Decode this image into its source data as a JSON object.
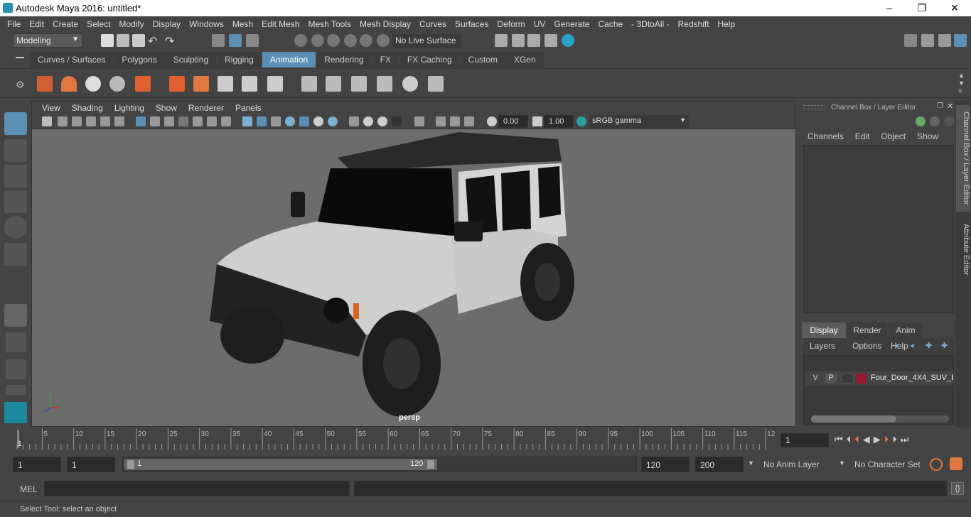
{
  "window": {
    "title": "Autodesk Maya 2016: untitled*",
    "minimize": "–",
    "restore": "❐",
    "close": "✕"
  },
  "menu": [
    "File",
    "Edit",
    "Create",
    "Select",
    "Modify",
    "Display",
    "Windows",
    "Mesh",
    "Edit Mesh",
    "Mesh Tools",
    "Mesh Display",
    "Curves",
    "Surfaces",
    "Deform",
    "UV",
    "Generate",
    "Cache",
    "- 3DtoAll -",
    "Redshift",
    "Help"
  ],
  "status": {
    "mode": "Modeling",
    "live_surface": "No Live Surface"
  },
  "shelf_tabs": [
    "Curves / Surfaces",
    "Polygons",
    "Sculpting",
    "Rigging",
    "Animation",
    "Rendering",
    "FX",
    "FX Caching",
    "Custom",
    "XGen"
  ],
  "shelf_active": "Animation",
  "viewport": {
    "menu": [
      "View",
      "Shading",
      "Lighting",
      "Show",
      "Renderer",
      "Panels"
    ],
    "exposure": "0.00",
    "gamma": "1.00",
    "colorspace": "sRGB gamma",
    "camera": "persp"
  },
  "channel_box": {
    "title": "Channel Box / Layer Editor",
    "menu": [
      "Channels",
      "Edit",
      "Object",
      "Show"
    ]
  },
  "layer_editor": {
    "tabs": [
      "Display",
      "Render",
      "Anim"
    ],
    "active_tab": "Display",
    "menu": [
      "Layers",
      "Options",
      "Help"
    ],
    "layer": {
      "v": "V",
      "p": "P",
      "name": "Four_Door_4X4_SUV_E",
      "color": "#9e1530"
    }
  },
  "side_tabs": [
    "Channel Box / Layer Editor",
    "Attribute Editor"
  ],
  "timeline": {
    "ticks": [
      "5",
      "10",
      "15",
      "20",
      "25",
      "30",
      "35",
      "40",
      "45",
      "50",
      "55",
      "60",
      "65",
      "70",
      "75",
      "80",
      "85",
      "90",
      "95",
      "100",
      "105",
      "110",
      "115",
      "12"
    ],
    "start_label": "1",
    "current_frame": "1"
  },
  "range": {
    "start": "1",
    "anim_start": "1",
    "slider_start": "1",
    "slider_end": "120",
    "end": "120",
    "anim_end": "200",
    "anim_layer": "No Anim Layer",
    "character_set": "No Character Set"
  },
  "mel": {
    "label": "MEL"
  },
  "help_line": "Select Tool: select an object",
  "colors": {
    "accent": "#5b8fb4",
    "bg": "#444444",
    "viewport": "#6c6c6c"
  }
}
